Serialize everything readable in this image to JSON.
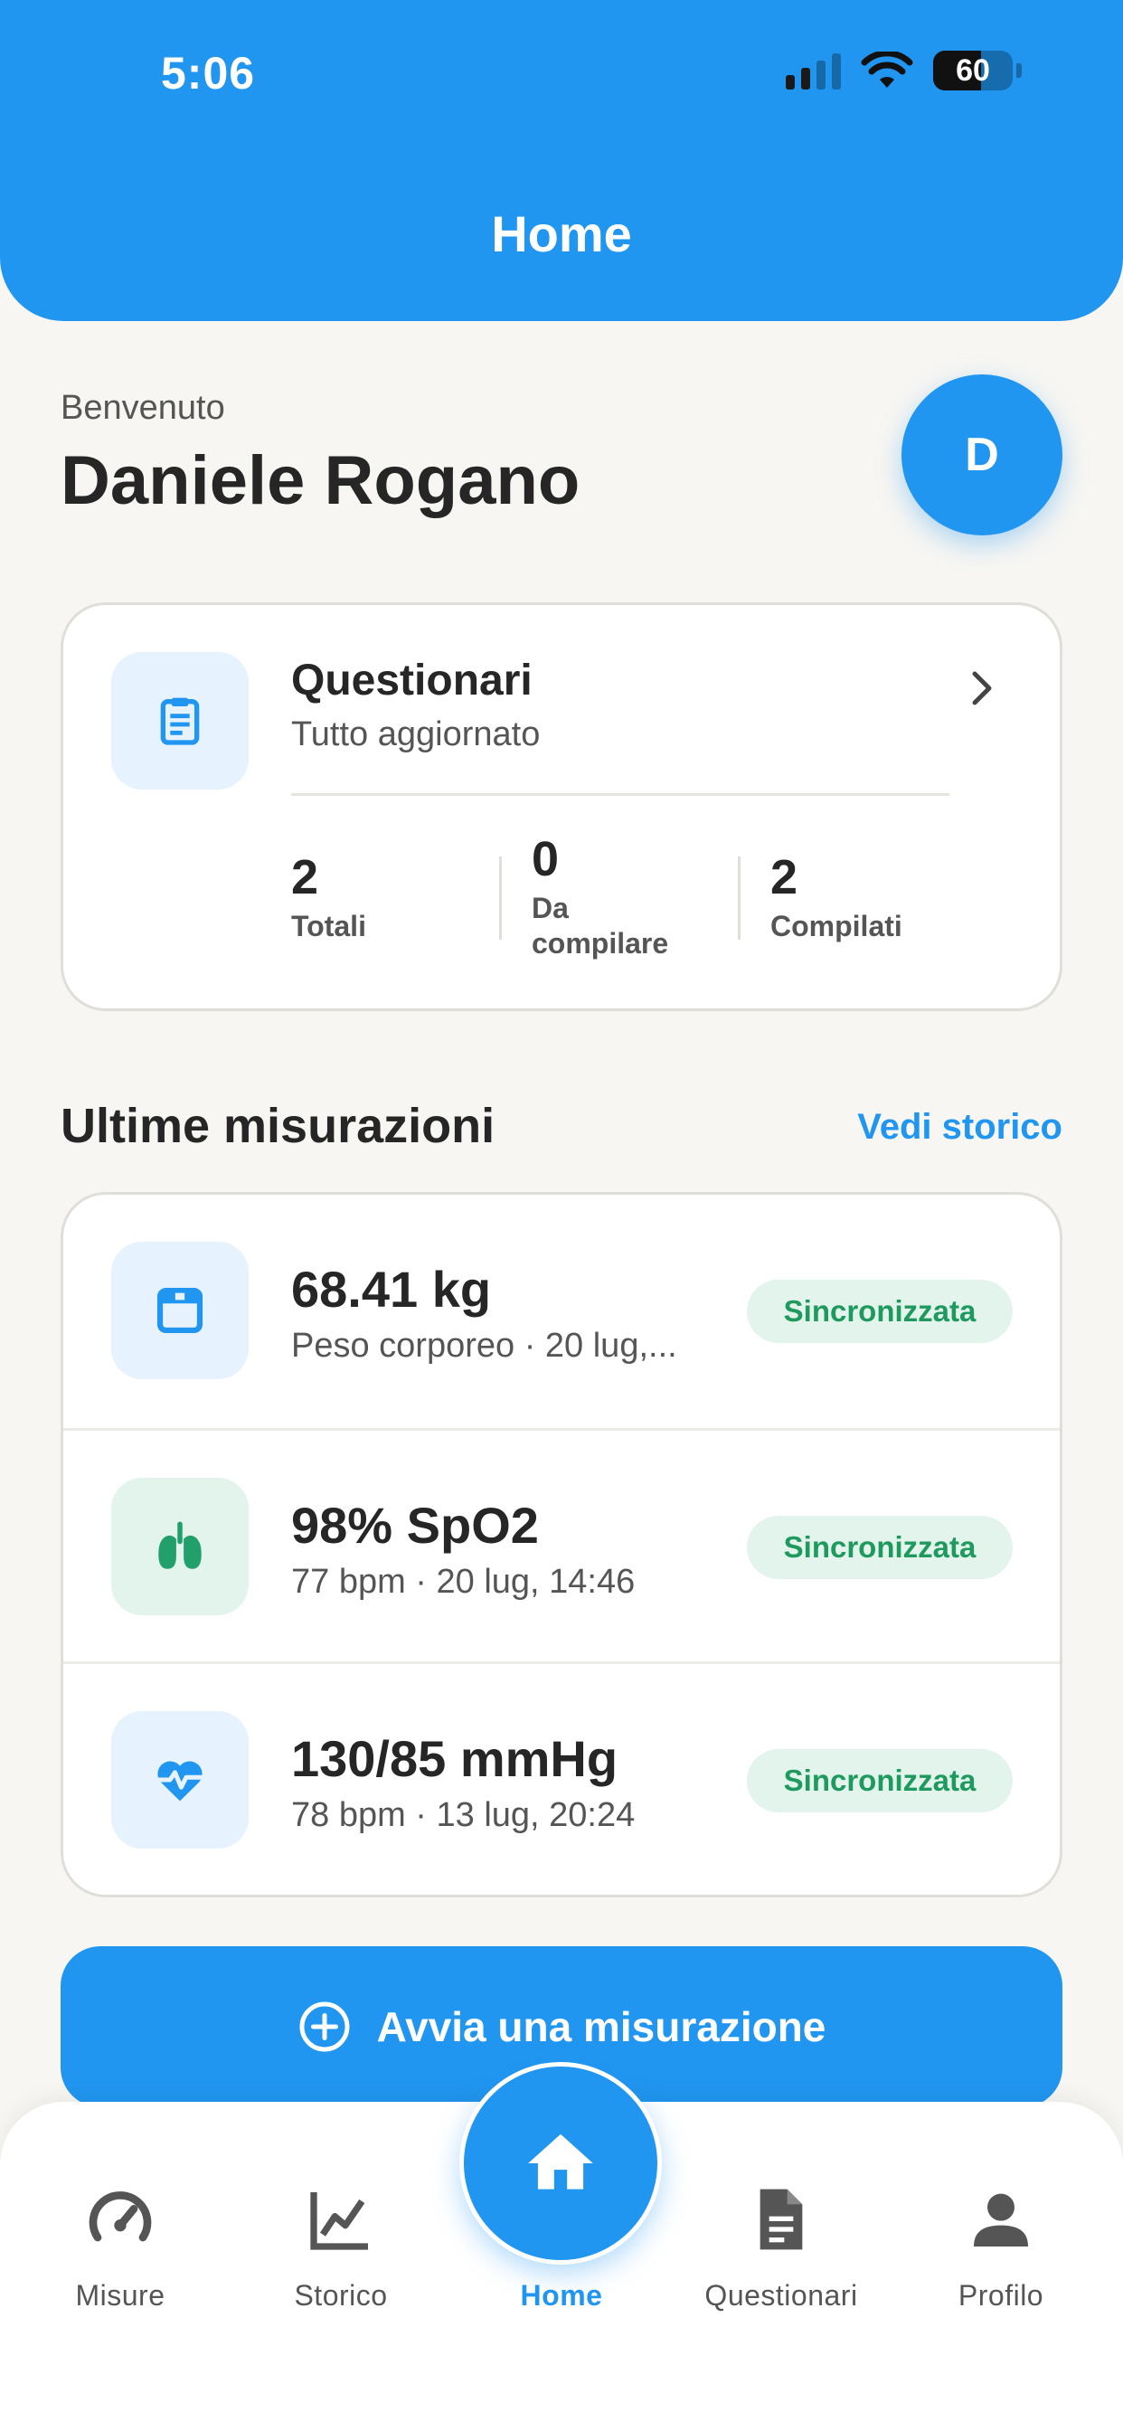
{
  "status_bar": {
    "time": "5:06",
    "battery": "60"
  },
  "header": {
    "title": "Home"
  },
  "welcome": {
    "label": "Benvenuto",
    "name": "Daniele Rogano",
    "avatar_initial": "D"
  },
  "questionnaires": {
    "title": "Questionari",
    "subtitle": "Tutto aggiornato",
    "stats": [
      {
        "value": "2",
        "label": "Totali"
      },
      {
        "value": "0",
        "label_line1": "Da",
        "label_line2": "compilare"
      },
      {
        "value": "2",
        "label": "Compilati"
      }
    ]
  },
  "measurements": {
    "section_title": "Ultime misurazioni",
    "history_link": "Vedi storico",
    "items": [
      {
        "value": "68.41 kg",
        "detail": "Peso corporeo · 20 lug,...",
        "status": "Sincronizzata",
        "icon": "scale-icon"
      },
      {
        "value": "98% SpO2",
        "detail": "77 bpm · 20 lug, 14:46",
        "status": "Sincronizzata",
        "icon": "lungs-icon"
      },
      {
        "value": "130/85 mmHg",
        "detail": "78 bpm · 13 lug, 20:24",
        "status": "Sincronizzata",
        "icon": "heart-pulse-icon"
      }
    ]
  },
  "cta": {
    "label": "Avvia una misurazione"
  },
  "tabs": [
    {
      "label": "Misure",
      "icon": "gauge-icon"
    },
    {
      "label": "Storico",
      "icon": "chart-icon"
    },
    {
      "label": "Home",
      "icon": "home-icon",
      "active": true
    },
    {
      "label": "Questionari",
      "icon": "document-icon"
    },
    {
      "label": "Profilo",
      "icon": "person-icon"
    }
  ],
  "colors": {
    "primary": "#2196f0",
    "success": "#1f9a5e",
    "success_bg": "#e3f4ec",
    "background": "#f7f6f3"
  }
}
